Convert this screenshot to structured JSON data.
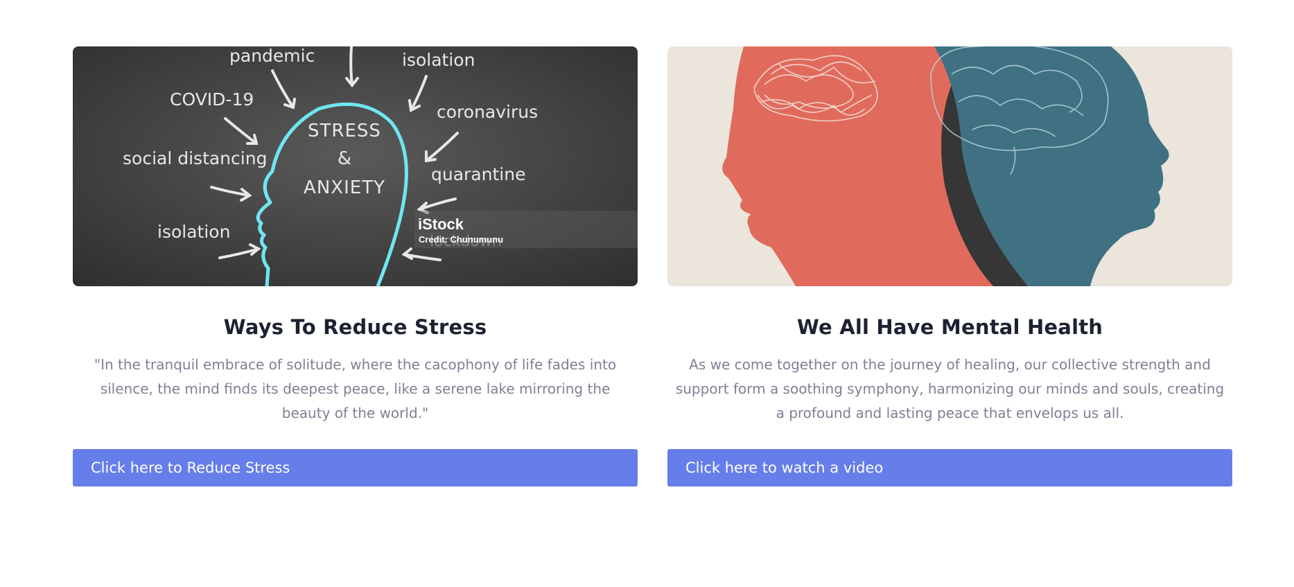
{
  "cards": [
    {
      "title": "Ways To Reduce Stress",
      "description": "\"In the tranquil embrace of solitude, where the cacophony of life fades into silence, the mind finds its deepest peace, like a serene lake mirroring the beauty of the world.\"",
      "button_label": "Click here to Reduce Stress",
      "image": {
        "chalk_words": [
          "pandemic",
          "isolation",
          "COVID-19",
          "coronavirus",
          "social distancing",
          "quarantine",
          "isolation",
          "lockdown"
        ],
        "head_text": [
          "STRESS",
          "&",
          "ANXIETY"
        ],
        "watermark_brand": "iStock",
        "watermark_credit": "Credit: Chunumunu"
      }
    },
    {
      "title": "We All Have Mental Health",
      "description": "As we come together on the journey of healing, our collective strength and support form a soothing symphony, harmonizing our minds and souls, creating a profound and lasting peace that envelops us all.",
      "button_label": "Click here to watch a video"
    }
  ],
  "colors": {
    "button": "#667eea",
    "title": "#1c2231",
    "description": "#7d8193",
    "chalkboard": "#4a4a4a",
    "head_outline": "#6fe6f2",
    "profile_coral": "#e06b5c",
    "profile_teal": "#3f7183",
    "profile_background": "#ebe5dc"
  }
}
